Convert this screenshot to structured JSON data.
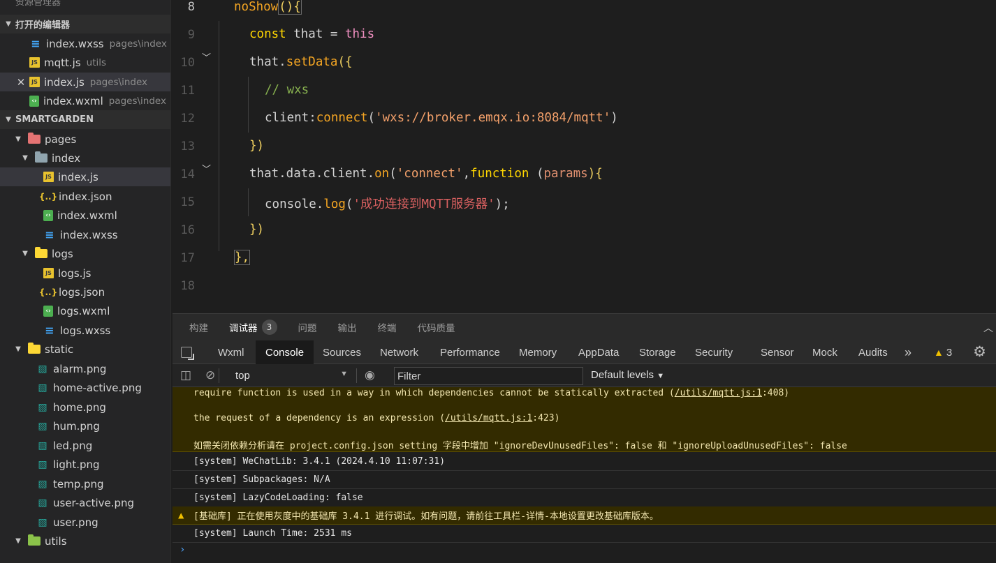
{
  "sidebar": {
    "top_title": "资源管理器",
    "open_editors_title": "打开的编辑器",
    "open_editors": [
      {
        "name": "index.wxss",
        "path": "pages\\index",
        "icon": "css-file-icon"
      },
      {
        "name": "mqtt.js",
        "path": "utils",
        "icon": "js-file-icon"
      },
      {
        "name": "index.js",
        "path": "pages\\index",
        "icon": "js-file-icon",
        "close": "✕"
      },
      {
        "name": "index.wxml",
        "path": "pages\\index",
        "icon": "wxml-file-icon"
      }
    ],
    "project_title": "SMARTGARDEN",
    "tree": {
      "pages": "pages",
      "index": "index",
      "index_js": "index.js",
      "index_json": "index.json",
      "index_wxml": "index.wxml",
      "index_wxss": "index.wxss",
      "logs": "logs",
      "logs_js": "logs.js",
      "logs_json": "logs.json",
      "logs_wxml": "logs.wxml",
      "logs_wxss": "logs.wxss",
      "static": "static",
      "static_files": [
        "alarm.png",
        "home-active.png",
        "home.png",
        "hum.png",
        "led.png",
        "light.png",
        "temp.png",
        "user-active.png",
        "user.png"
      ],
      "utils": "utils"
    }
  },
  "editor": {
    "line_numbers": [
      "8",
      "9",
      "10",
      "11",
      "12",
      "13",
      "14",
      "15",
      "16",
      "17",
      "18"
    ],
    "code": {
      "l8_fn": "noShow",
      "l8_rest": "(){",
      "l9_kw": "const",
      "l9_var": " that ",
      "l9_eq": "= ",
      "l9_this": "this",
      "l10_obj": "that.",
      "l10_fn": "setData",
      "l10_rest": "({",
      "l11_comment": "// wxs",
      "l12_key": "client",
      "l12_colon": ":",
      "l12_fn": "connect",
      "l12_open": "(",
      "l12_str": "'wxs://broker.emqx.io:8084/mqtt'",
      "l12_close": ")",
      "l13": "})",
      "l14_obj": "that.data.client.",
      "l14_fn": "on",
      "l14_open": "(",
      "l14_str": "'connect'",
      "l14_comma": ",",
      "l14_kw": "function",
      "l14_sp": " (",
      "l14_param": "params",
      "l14_rest": "){",
      "l15_obj": "console.",
      "l15_fn": "log",
      "l15_open": "(",
      "l15_str": "'成功连接到MQTT服务器'",
      "l15_rest": ");",
      "l16": "})",
      "l17": "},"
    }
  },
  "panel": {
    "tabs": [
      "构建",
      "调试器",
      "问题",
      "输出",
      "终端",
      "代码质量"
    ],
    "debugger_badge": "3",
    "devtools_tabs": [
      "Wxml",
      "Console",
      "Sources",
      "Network",
      "Performance",
      "Memory",
      "AppData",
      "Storage",
      "Security",
      "Sensor",
      "Mock",
      "Audits"
    ],
    "more": "»",
    "warning_count": "3",
    "context": "top",
    "filter_placeholder": "Filter",
    "levels": "Default levels",
    "console": {
      "warn_l1_a": "require function is used in a way in which dependencies cannot be statically extracted (",
      "warn_l1_link": "/utils/mqtt.js:1",
      "warn_l1_b": ":408)",
      "warn_l2_a": "the request of a dependency is an expression (",
      "warn_l2_link": "/utils/mqtt.js:1",
      "warn_l2_b": ":423)",
      "warn_l3": "如需关闭依赖分析请在 project.config.json setting 字段中增加 \"ignoreDevUnusedFiles\": false 和 \"ignoreUploadUnusedFiles\": false",
      "rows": [
        "[system] WeChatLib: 3.4.1 (2024.4.10 11:07:31)",
        "[system] Subpackages: N/A",
        "[system] LazyCodeLoading: false"
      ],
      "base_warn": "[基础库] 正在使用灰度中的基础库 3.4.1 进行调试。如有问题，请前往工具栏-详情-本地设置更改基础库版本。",
      "launch": "[system] Launch Time: 2531 ms",
      "prompt": "›"
    }
  }
}
